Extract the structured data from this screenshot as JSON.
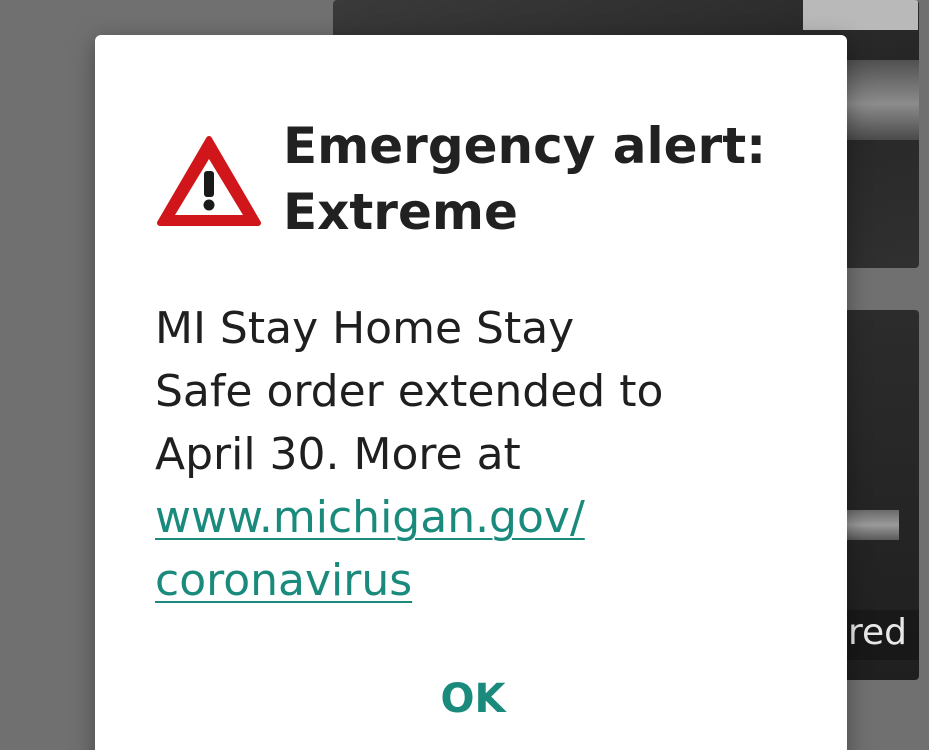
{
  "background": {
    "caption_partial": "red"
  },
  "dialog": {
    "icon": "warning-triangle-icon",
    "title_line1": "Emergency alert:",
    "title_line2": "Extreme",
    "body_text": "MI Stay Home Stay Safe order extended to April 30. More at",
    "link_line1": "www.michigan.gov/",
    "link_line2": "coronavirus",
    "ok_label": "OK"
  },
  "colors": {
    "accent": "#1a8a7c",
    "warning_red": "#d0161a",
    "title_text": "#212121",
    "scrim": "#707070"
  }
}
